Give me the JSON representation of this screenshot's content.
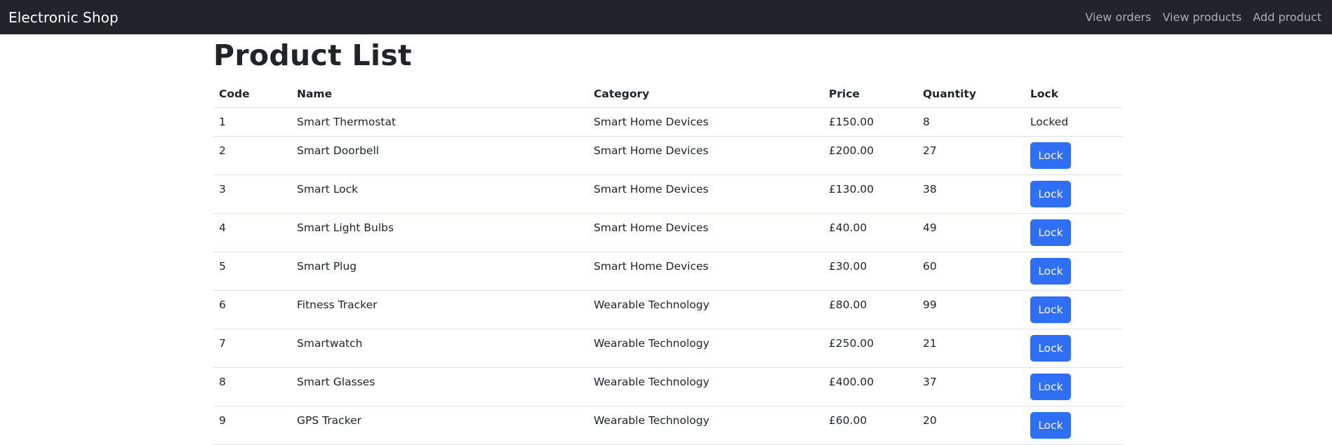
{
  "navbar": {
    "brand": "Electronic Shop",
    "links": [
      "View orders",
      "View products",
      "Add product"
    ]
  },
  "page": {
    "title": "Product List"
  },
  "table": {
    "headers": [
      "Code",
      "Name",
      "Category",
      "Price",
      "Quantity",
      "Lock"
    ],
    "rows": [
      {
        "code": "1",
        "name": "Smart Thermostat",
        "category": "Smart Home Devices",
        "price": "£150.00",
        "quantity": "8",
        "locked": true,
        "lock_text": "Locked"
      },
      {
        "code": "2",
        "name": "Smart Doorbell",
        "category": "Smart Home Devices",
        "price": "£200.00",
        "quantity": "27",
        "locked": false,
        "lock_text": "Lock"
      },
      {
        "code": "3",
        "name": "Smart Lock",
        "category": "Smart Home Devices",
        "price": "£130.00",
        "quantity": "38",
        "locked": false,
        "lock_text": "Lock"
      },
      {
        "code": "4",
        "name": "Smart Light Bulbs",
        "category": "Smart Home Devices",
        "price": "£40.00",
        "quantity": "49",
        "locked": false,
        "lock_text": "Lock"
      },
      {
        "code": "5",
        "name": "Smart Plug",
        "category": "Smart Home Devices",
        "price": "£30.00",
        "quantity": "60",
        "locked": false,
        "lock_text": "Lock"
      },
      {
        "code": "6",
        "name": "Fitness Tracker",
        "category": "Wearable Technology",
        "price": "£80.00",
        "quantity": "99",
        "locked": false,
        "lock_text": "Lock"
      },
      {
        "code": "7",
        "name": "Smartwatch",
        "category": "Wearable Technology",
        "price": "£250.00",
        "quantity": "21",
        "locked": false,
        "lock_text": "Lock"
      },
      {
        "code": "8",
        "name": "Smart Glasses",
        "category": "Wearable Technology",
        "price": "£400.00",
        "quantity": "37",
        "locked": false,
        "lock_text": "Lock"
      },
      {
        "code": "9",
        "name": "GPS Tracker",
        "category": "Wearable Technology",
        "price": "£60.00",
        "quantity": "20",
        "locked": false,
        "lock_text": "Lock"
      }
    ]
  },
  "colors": {
    "navbar_bg": "#212529",
    "button_primary": "#2f6ff5",
    "border": "#dee2e6"
  }
}
